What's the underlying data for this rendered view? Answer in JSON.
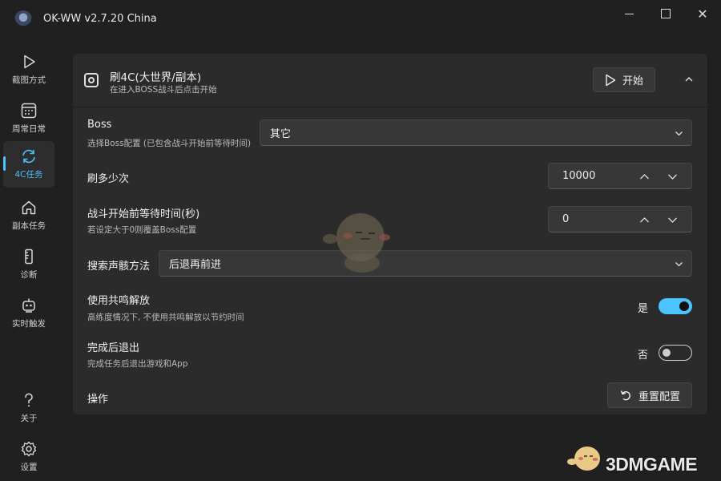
{
  "window": {
    "title": "OK-WW v2.7.20 China",
    "close_glyph": "✕"
  },
  "sidebar": {
    "items": [
      {
        "label": "截图方式",
        "icon": "play-icon"
      },
      {
        "label": "周常日常",
        "icon": "calendar-icon"
      },
      {
        "label": "4C任务",
        "icon": "refresh-icon",
        "active": true
      },
      {
        "label": "副本任务",
        "icon": "home-icon"
      },
      {
        "label": "诊断",
        "icon": "ruler-icon"
      },
      {
        "label": "实时触发",
        "icon": "robot-icon"
      }
    ],
    "bottom": [
      {
        "label": "关于",
        "icon": "help-icon"
      },
      {
        "label": "设置",
        "icon": "gear-icon"
      }
    ]
  },
  "task": {
    "title": "刷4C(大世界/副本)",
    "subtitle": "在进入BOSS战斗后点击开始",
    "start_label": "开始"
  },
  "settings": {
    "boss": {
      "label": "Boss",
      "desc": "选择Boss配置 (已包含战斗开始前等待时间)",
      "value": "其它"
    },
    "count": {
      "label": "刷多少次",
      "value": "10000"
    },
    "wait": {
      "label": "战斗开始前等待时间(秒)",
      "desc": "若设定大于0则覆盖Boss配置",
      "value": "0"
    },
    "search": {
      "label": "搜索声骸方法",
      "value": "后退再前进"
    },
    "resonance": {
      "label": "使用共鸣解放",
      "desc": "高练度情况下, 不使用共鸣解放以节约时间",
      "state": "是",
      "on": true
    },
    "exit": {
      "label": "完成后退出",
      "desc": "完成任务后退出游戏和App",
      "state": "否",
      "on": false
    },
    "actions": {
      "label": "操作",
      "reset_label": "重置配置"
    }
  },
  "watermark": {
    "text": "3DMGAME"
  },
  "colors": {
    "accent": "#4cc2ff",
    "background": "#202020",
    "card": "#2b2b2b"
  }
}
